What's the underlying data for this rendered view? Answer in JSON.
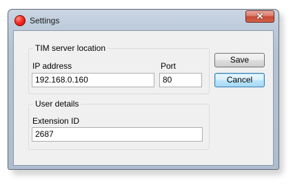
{
  "window": {
    "title": "Settings",
    "app_icon": "red-circle-icon",
    "close_glyph": "✕"
  },
  "server_group": {
    "title": "TIM server location",
    "ip_label": "IP address",
    "ip_value": "192.168.0.160",
    "port_label": "Port",
    "port_value": "80"
  },
  "user_group": {
    "title": "User details",
    "extension_label": "Extension ID",
    "extension_value": "2687"
  },
  "buttons": {
    "save_label": "Save",
    "cancel_label": "Cancel"
  },
  "colors": {
    "title_frame": "#b9c8d9",
    "client_background": "#f0f0f0",
    "close_button": "#c44a33",
    "focused_button_border": "#3c7fb1"
  }
}
